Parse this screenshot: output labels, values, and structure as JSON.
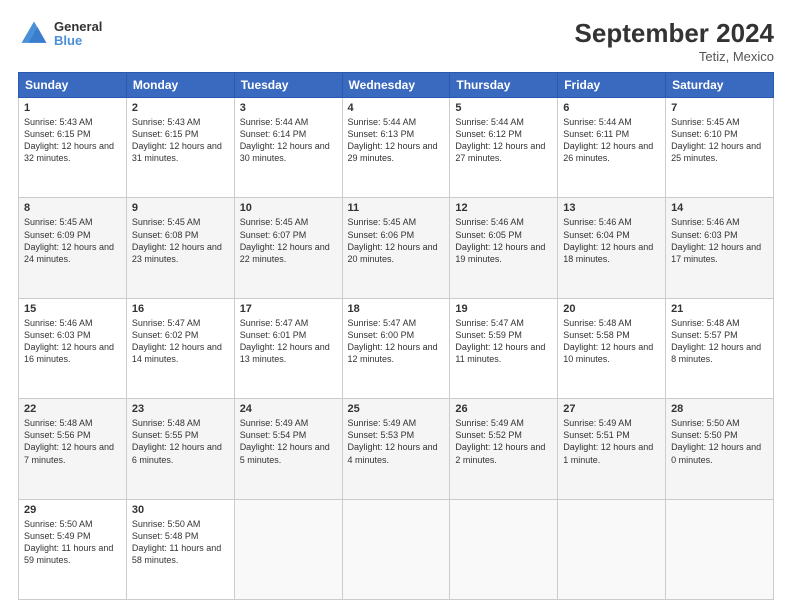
{
  "header": {
    "logo_line1": "General",
    "logo_line2": "Blue",
    "title": "September 2024",
    "subtitle": "Tetiz, Mexico"
  },
  "columns": [
    "Sunday",
    "Monday",
    "Tuesday",
    "Wednesday",
    "Thursday",
    "Friday",
    "Saturday"
  ],
  "weeks": [
    [
      {
        "day": "1",
        "sunrise": "5:43 AM",
        "sunset": "6:15 PM",
        "daylight": "12 hours and 32 minutes."
      },
      {
        "day": "2",
        "sunrise": "5:43 AM",
        "sunset": "6:15 PM",
        "daylight": "12 hours and 31 minutes."
      },
      {
        "day": "3",
        "sunrise": "5:44 AM",
        "sunset": "6:14 PM",
        "daylight": "12 hours and 30 minutes."
      },
      {
        "day": "4",
        "sunrise": "5:44 AM",
        "sunset": "6:13 PM",
        "daylight": "12 hours and 29 minutes."
      },
      {
        "day": "5",
        "sunrise": "5:44 AM",
        "sunset": "6:12 PM",
        "daylight": "12 hours and 27 minutes."
      },
      {
        "day": "6",
        "sunrise": "5:44 AM",
        "sunset": "6:11 PM",
        "daylight": "12 hours and 26 minutes."
      },
      {
        "day": "7",
        "sunrise": "5:45 AM",
        "sunset": "6:10 PM",
        "daylight": "12 hours and 25 minutes."
      }
    ],
    [
      {
        "day": "8",
        "sunrise": "5:45 AM",
        "sunset": "6:09 PM",
        "daylight": "12 hours and 24 minutes."
      },
      {
        "day": "9",
        "sunrise": "5:45 AM",
        "sunset": "6:08 PM",
        "daylight": "12 hours and 23 minutes."
      },
      {
        "day": "10",
        "sunrise": "5:45 AM",
        "sunset": "6:07 PM",
        "daylight": "12 hours and 22 minutes."
      },
      {
        "day": "11",
        "sunrise": "5:45 AM",
        "sunset": "6:06 PM",
        "daylight": "12 hours and 20 minutes."
      },
      {
        "day": "12",
        "sunrise": "5:46 AM",
        "sunset": "6:05 PM",
        "daylight": "12 hours and 19 minutes."
      },
      {
        "day": "13",
        "sunrise": "5:46 AM",
        "sunset": "6:04 PM",
        "daylight": "12 hours and 18 minutes."
      },
      {
        "day": "14",
        "sunrise": "5:46 AM",
        "sunset": "6:03 PM",
        "daylight": "12 hours and 17 minutes."
      }
    ],
    [
      {
        "day": "15",
        "sunrise": "5:46 AM",
        "sunset": "6:03 PM",
        "daylight": "12 hours and 16 minutes."
      },
      {
        "day": "16",
        "sunrise": "5:47 AM",
        "sunset": "6:02 PM",
        "daylight": "12 hours and 14 minutes."
      },
      {
        "day": "17",
        "sunrise": "5:47 AM",
        "sunset": "6:01 PM",
        "daylight": "12 hours and 13 minutes."
      },
      {
        "day": "18",
        "sunrise": "5:47 AM",
        "sunset": "6:00 PM",
        "daylight": "12 hours and 12 minutes."
      },
      {
        "day": "19",
        "sunrise": "5:47 AM",
        "sunset": "5:59 PM",
        "daylight": "12 hours and 11 minutes."
      },
      {
        "day": "20",
        "sunrise": "5:48 AM",
        "sunset": "5:58 PM",
        "daylight": "12 hours and 10 minutes."
      },
      {
        "day": "21",
        "sunrise": "5:48 AM",
        "sunset": "5:57 PM",
        "daylight": "12 hours and 8 minutes."
      }
    ],
    [
      {
        "day": "22",
        "sunrise": "5:48 AM",
        "sunset": "5:56 PM",
        "daylight": "12 hours and 7 minutes."
      },
      {
        "day": "23",
        "sunrise": "5:48 AM",
        "sunset": "5:55 PM",
        "daylight": "12 hours and 6 minutes."
      },
      {
        "day": "24",
        "sunrise": "5:49 AM",
        "sunset": "5:54 PM",
        "daylight": "12 hours and 5 minutes."
      },
      {
        "day": "25",
        "sunrise": "5:49 AM",
        "sunset": "5:53 PM",
        "daylight": "12 hours and 4 minutes."
      },
      {
        "day": "26",
        "sunrise": "5:49 AM",
        "sunset": "5:52 PM",
        "daylight": "12 hours and 2 minutes."
      },
      {
        "day": "27",
        "sunrise": "5:49 AM",
        "sunset": "5:51 PM",
        "daylight": "12 hours and 1 minute."
      },
      {
        "day": "28",
        "sunrise": "5:50 AM",
        "sunset": "5:50 PM",
        "daylight": "12 hours and 0 minutes."
      }
    ],
    [
      {
        "day": "29",
        "sunrise": "5:50 AM",
        "sunset": "5:49 PM",
        "daylight": "11 hours and 59 minutes."
      },
      {
        "day": "30",
        "sunrise": "5:50 AM",
        "sunset": "5:48 PM",
        "daylight": "11 hours and 58 minutes."
      },
      null,
      null,
      null,
      null,
      null
    ]
  ]
}
